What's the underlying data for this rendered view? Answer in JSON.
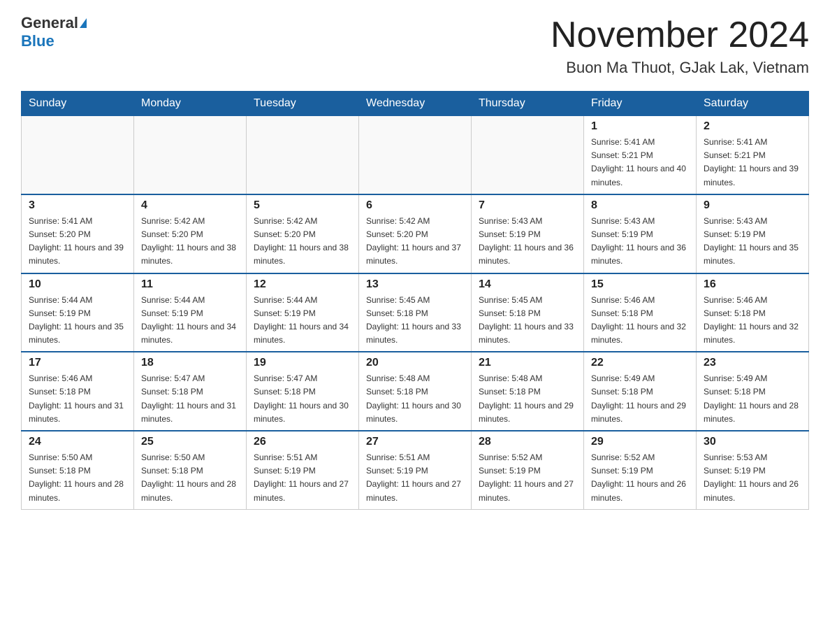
{
  "header": {
    "logo_general": "General",
    "logo_blue": "Blue",
    "month_year": "November 2024",
    "location": "Buon Ma Thuot, GJak Lak, Vietnam"
  },
  "days_of_week": [
    "Sunday",
    "Monday",
    "Tuesday",
    "Wednesday",
    "Thursday",
    "Friday",
    "Saturday"
  ],
  "weeks": [
    {
      "days": [
        {
          "number": "",
          "info": ""
        },
        {
          "number": "",
          "info": ""
        },
        {
          "number": "",
          "info": ""
        },
        {
          "number": "",
          "info": ""
        },
        {
          "number": "",
          "info": ""
        },
        {
          "number": "1",
          "info": "Sunrise: 5:41 AM\nSunset: 5:21 PM\nDaylight: 11 hours and 40 minutes."
        },
        {
          "number": "2",
          "info": "Sunrise: 5:41 AM\nSunset: 5:21 PM\nDaylight: 11 hours and 39 minutes."
        }
      ]
    },
    {
      "days": [
        {
          "number": "3",
          "info": "Sunrise: 5:41 AM\nSunset: 5:20 PM\nDaylight: 11 hours and 39 minutes."
        },
        {
          "number": "4",
          "info": "Sunrise: 5:42 AM\nSunset: 5:20 PM\nDaylight: 11 hours and 38 minutes."
        },
        {
          "number": "5",
          "info": "Sunrise: 5:42 AM\nSunset: 5:20 PM\nDaylight: 11 hours and 38 minutes."
        },
        {
          "number": "6",
          "info": "Sunrise: 5:42 AM\nSunset: 5:20 PM\nDaylight: 11 hours and 37 minutes."
        },
        {
          "number": "7",
          "info": "Sunrise: 5:43 AM\nSunset: 5:19 PM\nDaylight: 11 hours and 36 minutes."
        },
        {
          "number": "8",
          "info": "Sunrise: 5:43 AM\nSunset: 5:19 PM\nDaylight: 11 hours and 36 minutes."
        },
        {
          "number": "9",
          "info": "Sunrise: 5:43 AM\nSunset: 5:19 PM\nDaylight: 11 hours and 35 minutes."
        }
      ]
    },
    {
      "days": [
        {
          "number": "10",
          "info": "Sunrise: 5:44 AM\nSunset: 5:19 PM\nDaylight: 11 hours and 35 minutes."
        },
        {
          "number": "11",
          "info": "Sunrise: 5:44 AM\nSunset: 5:19 PM\nDaylight: 11 hours and 34 minutes."
        },
        {
          "number": "12",
          "info": "Sunrise: 5:44 AM\nSunset: 5:19 PM\nDaylight: 11 hours and 34 minutes."
        },
        {
          "number": "13",
          "info": "Sunrise: 5:45 AM\nSunset: 5:18 PM\nDaylight: 11 hours and 33 minutes."
        },
        {
          "number": "14",
          "info": "Sunrise: 5:45 AM\nSunset: 5:18 PM\nDaylight: 11 hours and 33 minutes."
        },
        {
          "number": "15",
          "info": "Sunrise: 5:46 AM\nSunset: 5:18 PM\nDaylight: 11 hours and 32 minutes."
        },
        {
          "number": "16",
          "info": "Sunrise: 5:46 AM\nSunset: 5:18 PM\nDaylight: 11 hours and 32 minutes."
        }
      ]
    },
    {
      "days": [
        {
          "number": "17",
          "info": "Sunrise: 5:46 AM\nSunset: 5:18 PM\nDaylight: 11 hours and 31 minutes."
        },
        {
          "number": "18",
          "info": "Sunrise: 5:47 AM\nSunset: 5:18 PM\nDaylight: 11 hours and 31 minutes."
        },
        {
          "number": "19",
          "info": "Sunrise: 5:47 AM\nSunset: 5:18 PM\nDaylight: 11 hours and 30 minutes."
        },
        {
          "number": "20",
          "info": "Sunrise: 5:48 AM\nSunset: 5:18 PM\nDaylight: 11 hours and 30 minutes."
        },
        {
          "number": "21",
          "info": "Sunrise: 5:48 AM\nSunset: 5:18 PM\nDaylight: 11 hours and 29 minutes."
        },
        {
          "number": "22",
          "info": "Sunrise: 5:49 AM\nSunset: 5:18 PM\nDaylight: 11 hours and 29 minutes."
        },
        {
          "number": "23",
          "info": "Sunrise: 5:49 AM\nSunset: 5:18 PM\nDaylight: 11 hours and 28 minutes."
        }
      ]
    },
    {
      "days": [
        {
          "number": "24",
          "info": "Sunrise: 5:50 AM\nSunset: 5:18 PM\nDaylight: 11 hours and 28 minutes."
        },
        {
          "number": "25",
          "info": "Sunrise: 5:50 AM\nSunset: 5:18 PM\nDaylight: 11 hours and 28 minutes."
        },
        {
          "number": "26",
          "info": "Sunrise: 5:51 AM\nSunset: 5:19 PM\nDaylight: 11 hours and 27 minutes."
        },
        {
          "number": "27",
          "info": "Sunrise: 5:51 AM\nSunset: 5:19 PM\nDaylight: 11 hours and 27 minutes."
        },
        {
          "number": "28",
          "info": "Sunrise: 5:52 AM\nSunset: 5:19 PM\nDaylight: 11 hours and 27 minutes."
        },
        {
          "number": "29",
          "info": "Sunrise: 5:52 AM\nSunset: 5:19 PM\nDaylight: 11 hours and 26 minutes."
        },
        {
          "number": "30",
          "info": "Sunrise: 5:53 AM\nSunset: 5:19 PM\nDaylight: 11 hours and 26 minutes."
        }
      ]
    }
  ],
  "colors": {
    "header_bg": "#1a5f9e",
    "header_text": "#ffffff",
    "border": "#aaaaaa",
    "logo_blue": "#1a75bb"
  }
}
